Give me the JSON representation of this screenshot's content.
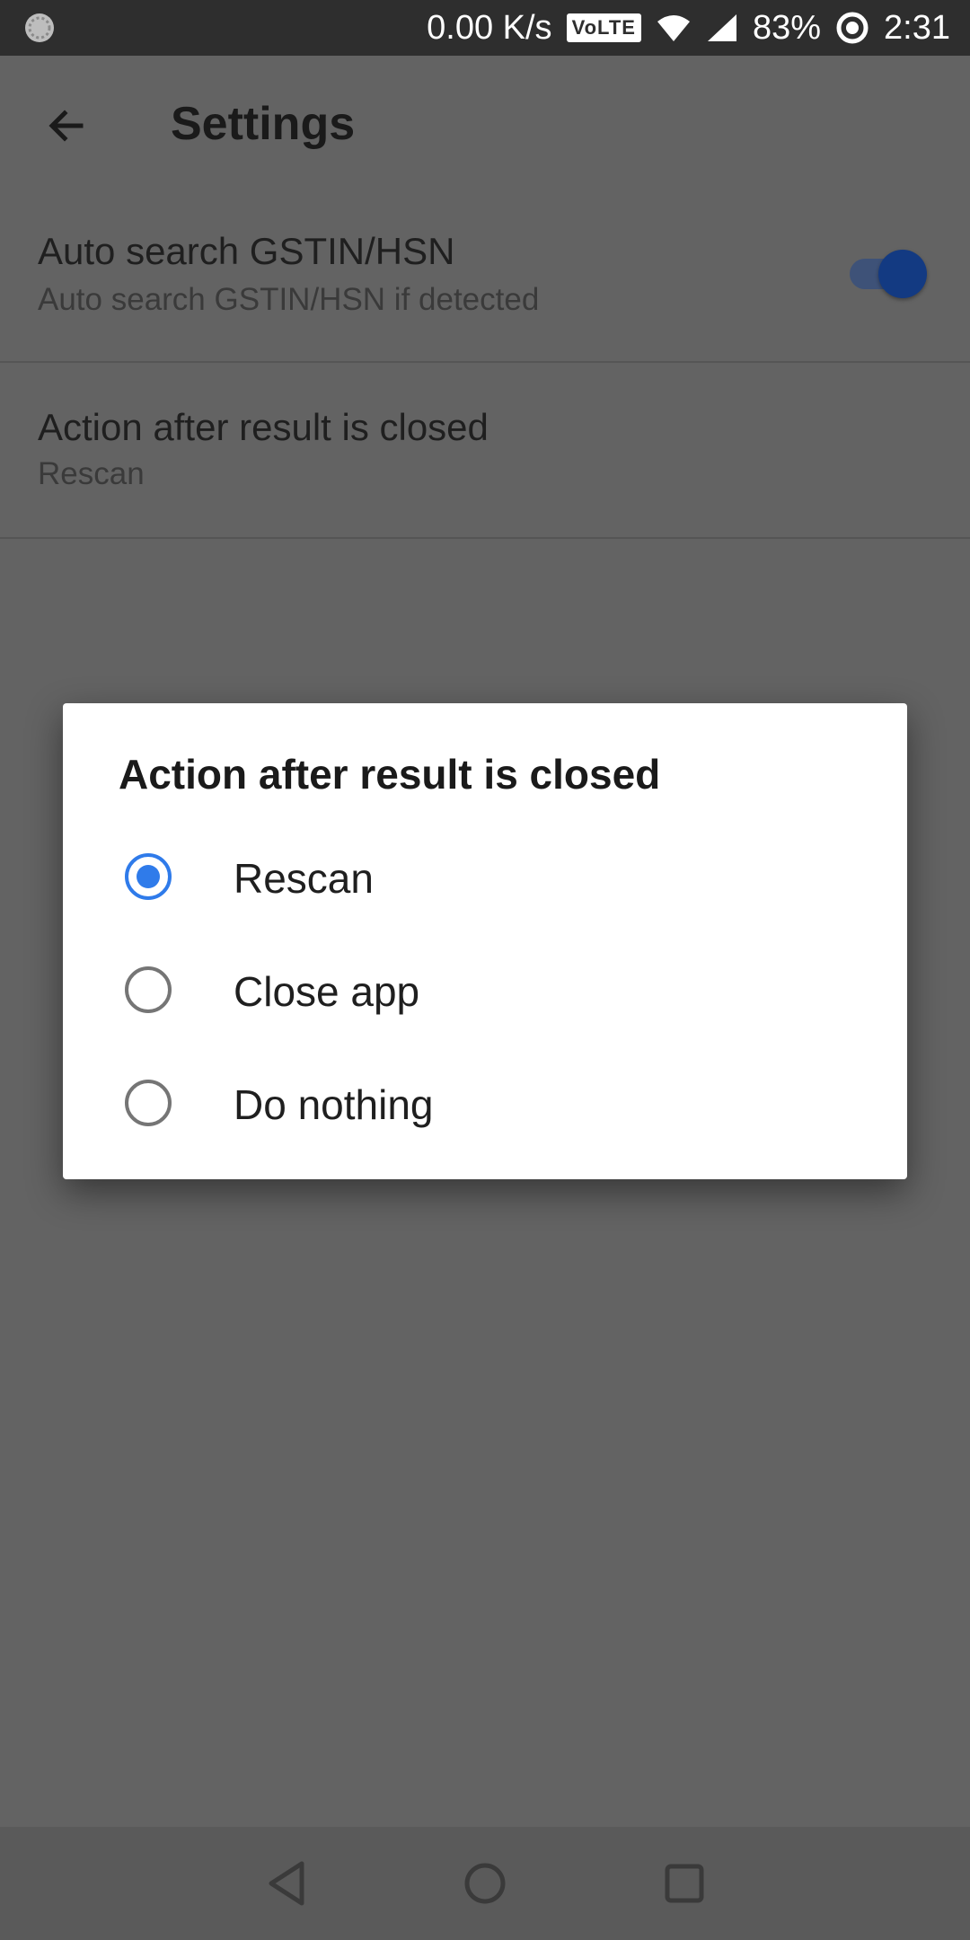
{
  "status_bar": {
    "network_speed": "0.00 K/s",
    "volte_label": "VoLTE",
    "battery": "83%",
    "time": "2:31"
  },
  "app_bar": {
    "title": "Settings",
    "back_icon": "arrow-back-icon"
  },
  "preferences": [
    {
      "title": "Auto search GSTIN/HSN",
      "summary": "Auto search GSTIN/HSN if detected",
      "switch_on": true
    },
    {
      "title": "Action after result is closed",
      "summary": "Rescan"
    }
  ],
  "dialog": {
    "title": "Action after result is closed",
    "options": [
      {
        "label": "Rescan",
        "selected": true
      },
      {
        "label": "Close app",
        "selected": false
      },
      {
        "label": "Do nothing",
        "selected": false
      }
    ]
  },
  "colors": {
    "accent": "#2f7bea",
    "switch_thumb": "#133a82",
    "scrim_background": "#636363",
    "status_bar": "#2e2e2e"
  },
  "nav_bar": {
    "icons": [
      "back-triangle-icon",
      "home-circle-icon",
      "recents-square-icon"
    ]
  }
}
